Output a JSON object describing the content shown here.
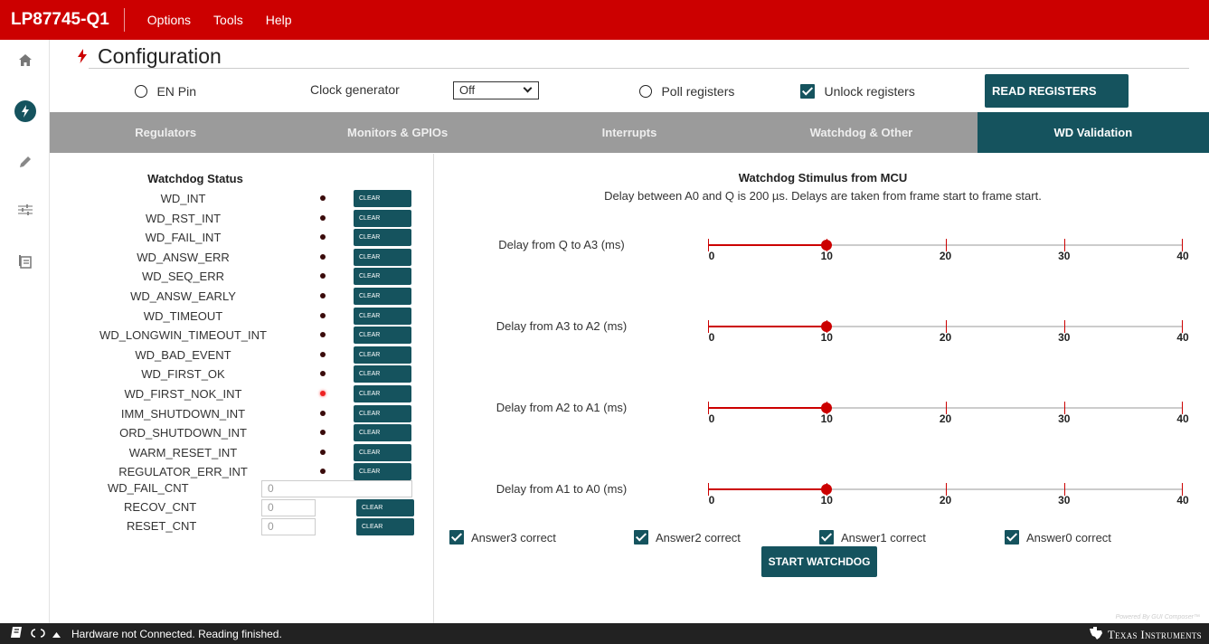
{
  "app": {
    "title": "LP87745-Q1",
    "menus": [
      "Options",
      "Tools",
      "Help"
    ]
  },
  "page": {
    "title": "Configuration"
  },
  "controls": {
    "en_pin_label": "EN Pin",
    "clock_label": "Clock generator",
    "clock_value": "Off",
    "poll_label": "Poll registers",
    "unlock_label": "Unlock registers",
    "unlock_checked": true,
    "read_button": "READ REGISTERS"
  },
  "tabs": [
    {
      "label": "Regulators",
      "active": false
    },
    {
      "label": "Monitors & GPIOs",
      "active": false
    },
    {
      "label": "Interrupts",
      "active": false
    },
    {
      "label": "Watchdog & Other",
      "active": false
    },
    {
      "label": "WD Validation",
      "active": true
    }
  ],
  "status": {
    "title": "Watchdog Status",
    "clear_label": "CLEAR",
    "flags": [
      {
        "name": "WD_INT",
        "active": false
      },
      {
        "name": "WD_RST_INT",
        "active": false
      },
      {
        "name": "WD_FAIL_INT",
        "active": false
      },
      {
        "name": "WD_ANSW_ERR",
        "active": false
      },
      {
        "name": "WD_SEQ_ERR",
        "active": false
      },
      {
        "name": "WD_ANSW_EARLY",
        "active": false
      },
      {
        "name": "WD_TIMEOUT",
        "active": false
      },
      {
        "name": "WD_LONGWIN_TIMEOUT_INT",
        "active": false
      },
      {
        "name": "WD_BAD_EVENT",
        "active": false
      },
      {
        "name": "WD_FIRST_OK",
        "active": false
      },
      {
        "name": "WD_FIRST_NOK_INT",
        "active": true
      },
      {
        "name": "IMM_SHUTDOWN_INT",
        "active": false
      },
      {
        "name": "ORD_SHUTDOWN_INT",
        "active": false
      },
      {
        "name": "WARM_RESET_INT",
        "active": false
      },
      {
        "name": "REGULATOR_ERR_INT",
        "active": false
      }
    ],
    "counters": [
      {
        "name": "WD_FAIL_CNT",
        "value": "0"
      },
      {
        "name": "RECOV_CNT",
        "value": "0"
      },
      {
        "name": "RESET_CNT",
        "value": "0"
      }
    ]
  },
  "stimulus": {
    "title": "Watchdog Stimulus from MCU",
    "description": "Delay between A0 and Q is 200 µs. Delays are taken from frame start to frame start.",
    "scale": {
      "min": 0,
      "max": 40,
      "labels": [
        "0",
        "10",
        "20",
        "30",
        "40"
      ],
      "ticks": [
        0,
        10,
        20,
        30,
        40
      ]
    },
    "delays": [
      {
        "label": "Delay from Q to A3 (ms)",
        "value": 10
      },
      {
        "label": "Delay from A3 to A2 (ms)",
        "value": 10
      },
      {
        "label": "Delay from A2 to A1 (ms)",
        "value": 10
      },
      {
        "label": "Delay from A1 to A0 (ms)",
        "value": 10
      }
    ],
    "answers": [
      {
        "label": "Answer3 correct",
        "checked": true
      },
      {
        "label": "Answer2 correct",
        "checked": true
      },
      {
        "label": "Answer1 correct",
        "checked": true
      },
      {
        "label": "Answer0 correct",
        "checked": true
      }
    ],
    "start_button": "START WATCHDOG"
  },
  "footer": {
    "powered_by": "Powered By GUI Composer™",
    "status_text": "Hardware not Connected.  Reading finished.",
    "brand": "Texas Instruments"
  },
  "colors": {
    "brand_red": "#cc0000",
    "teal": "#15535e",
    "tab_gray": "#9b9b9b"
  }
}
